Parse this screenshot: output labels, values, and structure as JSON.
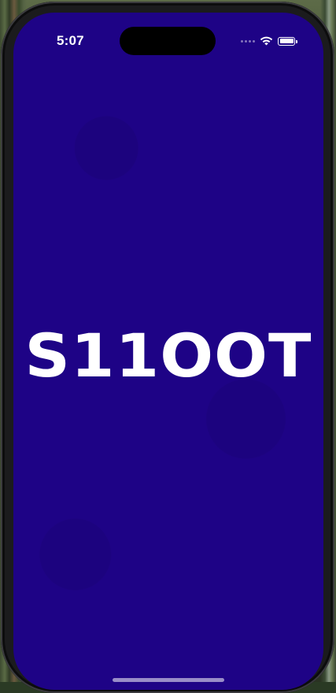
{
  "status_bar": {
    "time": "5:07",
    "icons": [
      "cellular-signal-icon",
      "wifi-icon",
      "battery-icon"
    ],
    "battery_level": 1.0
  },
  "splash": {
    "logo_text": "S11OOT"
  },
  "colors": {
    "background": "#1e0386",
    "logo": "#ffffff"
  }
}
